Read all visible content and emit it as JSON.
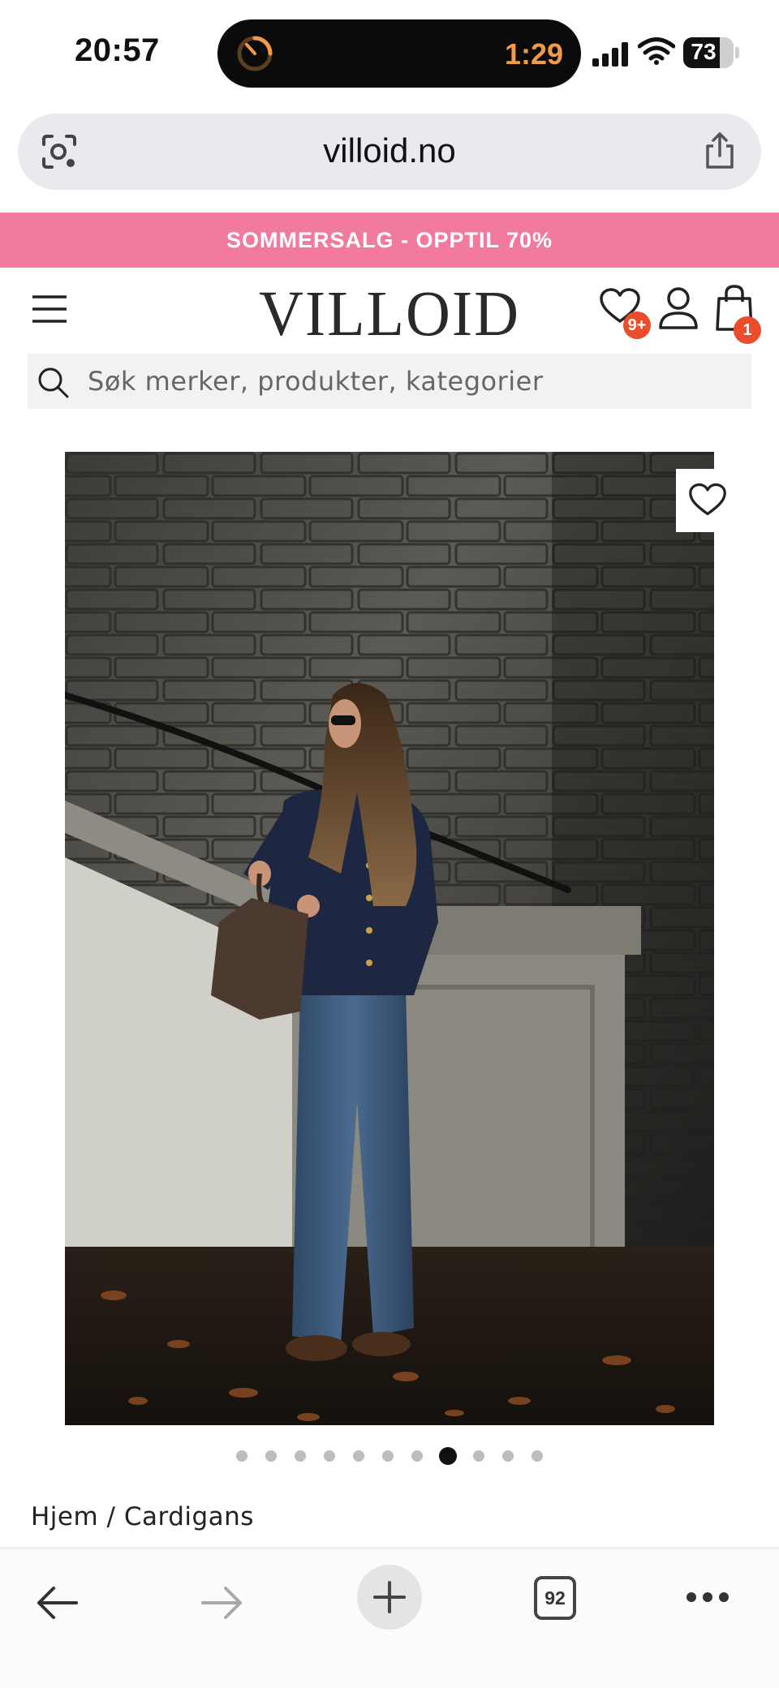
{
  "status_bar": {
    "time": "20:57",
    "timer": "1:29",
    "battery": "73",
    "battery_level": 0.73
  },
  "browser": {
    "url": "villoid.no"
  },
  "promo": {
    "text": "SOMMERSALG - OPPTIL 70%",
    "color": "#f27a9e"
  },
  "header": {
    "logo": "VILLOID",
    "wishlist_badge": "9+",
    "cart_badge": "1",
    "badge_color": "#ea4c2c"
  },
  "search": {
    "placeholder": "Søk merker, produkter, kategorier"
  },
  "carousel": {
    "total": 11,
    "active_index": 7
  },
  "breadcrumb": "Hjem / Cardigans",
  "toolbar": {
    "tab_count": "92"
  }
}
